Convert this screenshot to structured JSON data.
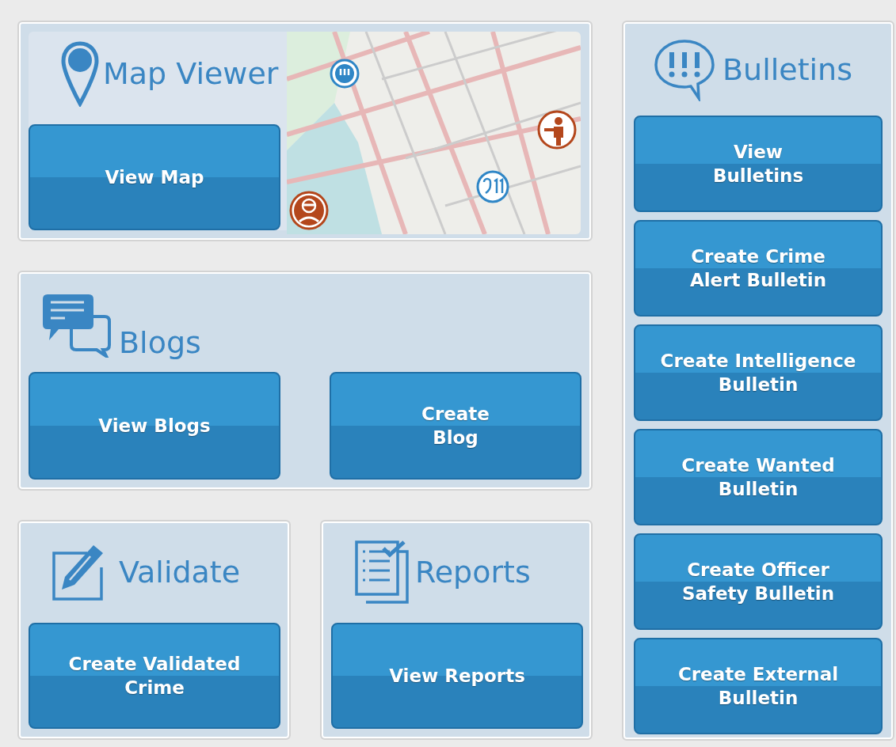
{
  "map_viewer": {
    "title": "Map Viewer",
    "buttons": [
      "View Map"
    ]
  },
  "blogs": {
    "title": "Blogs",
    "buttons": [
      "View Blogs",
      "Create\nBlog"
    ]
  },
  "validate": {
    "title": "Validate",
    "buttons": [
      "Create Validated\nCrime"
    ]
  },
  "reports": {
    "title": "Reports",
    "buttons": [
      "View Reports"
    ]
  },
  "bulletins": {
    "title": "Bulletins",
    "buttons": [
      "View\nBulletins",
      "Create Crime\nAlert Bulletin",
      "Create Intelligence\nBulletin",
      "Create Wanted\nBulletin",
      "Create Officer\nSafety Bulletin",
      "Create External\nBulletin"
    ]
  }
}
